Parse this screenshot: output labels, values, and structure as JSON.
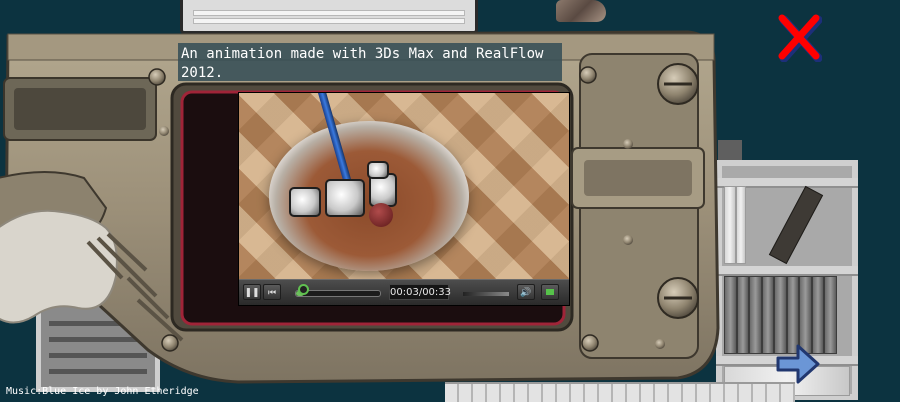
{
  "caption": "An animation made with 3Ds Max and RealFlow 2012.",
  "player": {
    "play_pause_icon": "pause-icon",
    "previous_icon": "skip-back-icon",
    "time": "00:03/00:33",
    "progress_fraction": 0.09,
    "volume_icon": "speaker-icon",
    "fullscreen_icon": "fullscreen-icon",
    "accent": "#60c050"
  },
  "close_button": {
    "icon": "close-x-icon",
    "color": "#ff0000"
  },
  "next_button": {
    "icon": "right-arrow-icon",
    "color": "#6b96d6"
  },
  "credits": "Music:Blue Ice by John Etheridge",
  "colors": {
    "background": "#0c3340",
    "caption_bg": "#374e56",
    "frame_metal": "#9c9079"
  }
}
